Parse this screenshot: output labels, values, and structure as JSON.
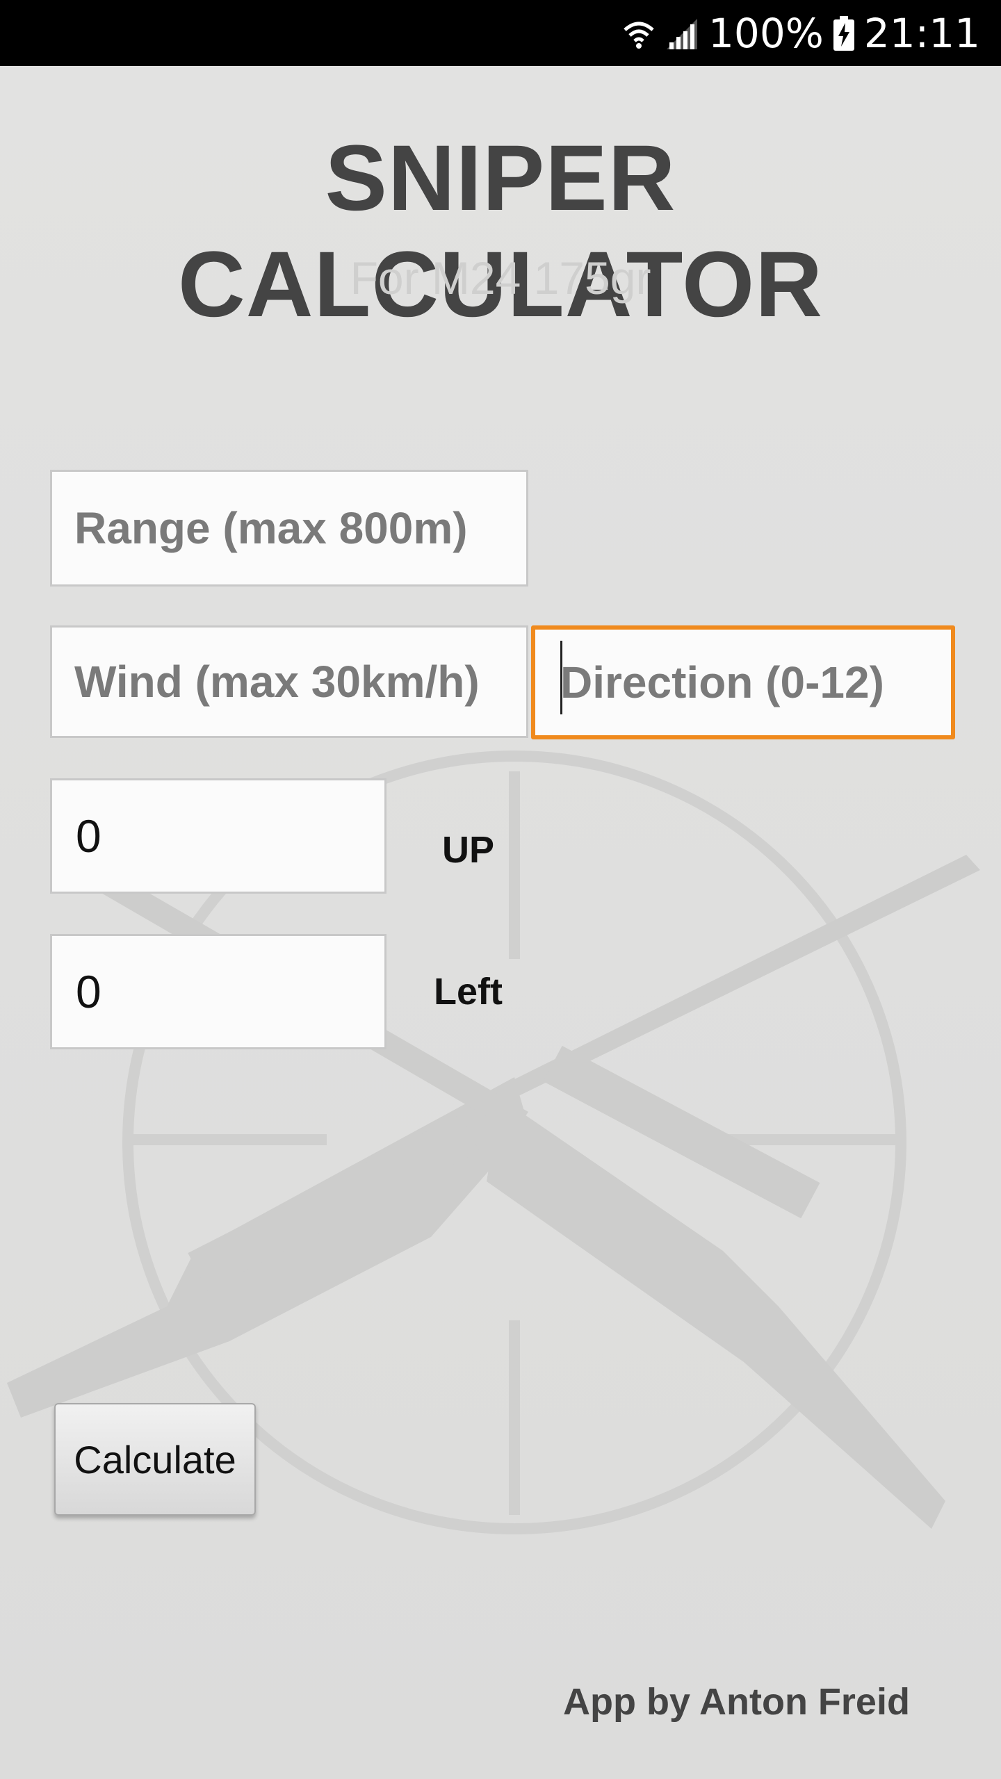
{
  "status_bar": {
    "battery": "100%",
    "time": "21:11",
    "icons": [
      "wifi-icon",
      "signal-icon",
      "battery-charging-icon"
    ]
  },
  "header": {
    "title": "SNIPER CALCULATOR",
    "subtitle": "For M24 175gr"
  },
  "form": {
    "range_placeholder": "Range (max 800m)",
    "wind_placeholder": "Wind (max 30km/h)",
    "direction_placeholder": "Direction (0-12)",
    "up_value": "0",
    "up_label": "UP",
    "left_value": "0",
    "left_label": "Left",
    "calculate_label": "Calculate"
  },
  "footer": {
    "credit": "App by Anton Freid"
  },
  "colors": {
    "focus_accent": "#f08a1d",
    "title_text": "#444444",
    "background": "#dededd"
  }
}
